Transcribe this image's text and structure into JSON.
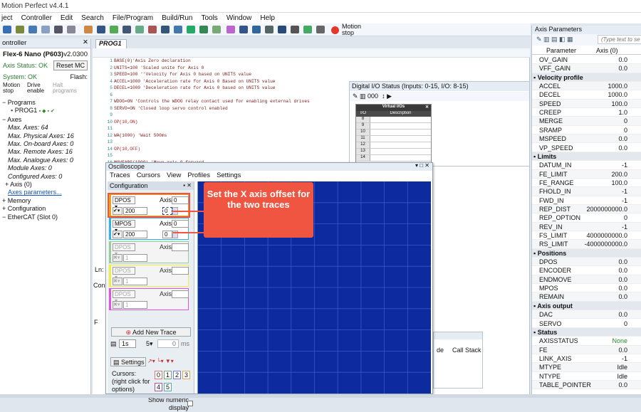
{
  "app": {
    "title": "Motion Perfect v4.4.1"
  },
  "menu": [
    "ject",
    "Controller",
    "Edit",
    "Search",
    "File/Program",
    "Build/Run",
    "Tools",
    "Window",
    "Help"
  ],
  "motion_stop": {
    "label": "Motion stop"
  },
  "controller": {
    "panel_title": "ontroller",
    "device": "Flex-6 Nano (P603)",
    "version": "v2.0300",
    "axis_status_label": "Axis Status: OK",
    "reset_button": "Reset MC",
    "system_status": "System: OK",
    "flash_label": "Flash:",
    "motion_stop": "Motion stop",
    "drive_enable": "Drive enable",
    "halt_programs": "Halt programs",
    "tree": {
      "programs": "Programs",
      "prog1": "PROG1",
      "axes": "Axes",
      "max_axes": "Max. Axes: 64",
      "max_physical": "Max. Physical Axes: 16",
      "max_onboard": "Max. On-board Axes: 0",
      "max_remote": "Max. Remote Axes: 16",
      "max_analogue": "Max. Analogue Axes: 0",
      "module_axes": "Module Axes: 0",
      "configured_axes": "Configured Axes: 0",
      "axis0": "Axis (0)",
      "axes_params_link": "Axes parameters...",
      "memory": "Memory",
      "configuration": "Configuration",
      "ethercat": "EtherCAT (Slot 0)"
    }
  },
  "editor": {
    "tab": "PROG1",
    "lines": [
      "BASE(0)'Axis Zero declaration",
      "UNITS=100 'Scaled unite for Axis 0",
      "SPEED=100 ''Velocity for Axis 0 based on UNITS value",
      "ACCEL=1000 'Acceleration rate for Axis 0 Based on UNITS value",
      "DECEL=1000 'Deceleration rate for Axis 0 based on UNITS value",
      "",
      "WDOG=ON 'Controls the WDOG relay contact used for enabling external drives",
      "SERVO=ON 'Closed loop servo control enabled",
      "",
      "OP(10,ON)",
      "",
      "WA(1000) 'Wait 500ms",
      "",
      "OP(10,OFF)",
      "",
      "MOVEABS(1000) 'Move axis 0 forward",
      "WAIT IDLE 'wait until move is finished",
      "",
      "OP(10,ON)"
    ],
    "line_numbers": [
      "1",
      "2",
      "3",
      "4",
      "5",
      "6",
      "7",
      "8",
      "9",
      "10",
      "11",
      "12",
      "13",
      "14",
      "15",
      "16",
      "17",
      "18",
      "19",
      "20",
      "21",
      "22",
      "23",
      "24",
      "25",
      "26",
      "27",
      "28",
      "29",
      "30",
      "31",
      "32",
      "33",
      "34",
      "35"
    ],
    "ln_label": "Ln:",
    "con_label": "Con",
    "f_label": "F",
    "call_stack": "Call Stack",
    "cut_label": "de"
  },
  "digital_io": {
    "title": "Digital I/O Status (Inputs: 0-15,  I/O: 8-15)",
    "toolbar_value": "000",
    "table_title": "Virtual I/Os",
    "col_io": "I/O",
    "col_desc": "Description",
    "rows": [
      "8",
      "9",
      "10",
      "11",
      "12",
      "13",
      "14"
    ]
  },
  "oscilloscope": {
    "title": "Oscilloscope",
    "menu": [
      "Traces",
      "Cursors",
      "View",
      "Profiles",
      "Settings"
    ],
    "config_label": "Configuration",
    "traces": [
      {
        "param": "DPOS",
        "axis_label": "Axis",
        "axis": "0",
        "scale": "200",
        "offset": "0"
      },
      {
        "param": "MPOS",
        "axis_label": "Axis",
        "axis": "0",
        "scale": "200",
        "offset": "0"
      },
      {
        "param": "DPOS",
        "axis_label": "Axis",
        "axis": "",
        "scale": "1",
        "offset": ""
      },
      {
        "param": "DPOS",
        "axis_label": "Axis",
        "axis": "",
        "scale": "1",
        "offset": ""
      },
      {
        "param": "DPOS",
        "axis_label": "Axis",
        "axis": "",
        "scale": "1",
        "offset": ""
      }
    ],
    "add_trace": "Add New Trace",
    "time_value": "1s",
    "samples_value": "0",
    "samples_unit": "ms",
    "settings_button": "Settings",
    "cursors_label": "Cursors:",
    "cursors_hint": "(right click for options)",
    "cursor_buttons": [
      "0",
      "1",
      "2",
      "3",
      "4",
      "5"
    ],
    "show_numeric": "Show numeric display"
  },
  "callout": {
    "text": "Set the X axis offset for the two traces"
  },
  "axis_params": {
    "title": "Axis Parameters",
    "search_placeholder": "(Type text to se",
    "col_param": "Parameter",
    "col_axis": "Axis (0)",
    "rows": [
      {
        "k": "OV_GAIN",
        "v": "0.0"
      },
      {
        "k": "VFF_GAIN",
        "v": "0.0"
      },
      {
        "section": "Velocity profile"
      },
      {
        "k": "ACCEL",
        "v": "1000.0"
      },
      {
        "k": "DECEL",
        "v": "1000.0"
      },
      {
        "k": "SPEED",
        "v": "100.0"
      },
      {
        "k": "CREEP",
        "v": "1.0"
      },
      {
        "k": "MERGE",
        "v": "0"
      },
      {
        "k": "SRAMP",
        "v": "0"
      },
      {
        "k": "MSPEED",
        "v": "0.0"
      },
      {
        "k": "VP_SPEED",
        "v": "0.0"
      },
      {
        "section": "Limits"
      },
      {
        "k": "DATUM_IN",
        "v": "-1"
      },
      {
        "k": "FE_LIMIT",
        "v": "200.0"
      },
      {
        "k": "FE_RANGE",
        "v": "100.0"
      },
      {
        "k": "FHOLD_IN",
        "v": "-1"
      },
      {
        "k": "FWD_IN",
        "v": "-1"
      },
      {
        "k": "REP_DIST",
        "v": "2000000000.0"
      },
      {
        "k": "REP_OPTION",
        "v": "0"
      },
      {
        "k": "REV_IN",
        "v": "-1"
      },
      {
        "k": "FS_LIMIT",
        "v": "4000000000.0"
      },
      {
        "k": "RS_LIMIT",
        "v": "-4000000000.0"
      },
      {
        "section": "Positions"
      },
      {
        "k": "DPOS",
        "v": "0.0"
      },
      {
        "k": "ENCODER",
        "v": "0.0"
      },
      {
        "k": "ENDMOVE",
        "v": "0.0"
      },
      {
        "k": "MPOS",
        "v": "0.0"
      },
      {
        "k": "REMAIN",
        "v": "0.0"
      },
      {
        "section": "Axis output"
      },
      {
        "k": "DAC",
        "v": "0.0"
      },
      {
        "k": "SERVO",
        "v": "0"
      },
      {
        "section": "Status"
      },
      {
        "k": "AXISSTATUS",
        "v": "None"
      },
      {
        "k": "FE",
        "v": "0.0"
      },
      {
        "k": "LINK_AXIS",
        "v": "-1"
      },
      {
        "k": "MTYPE",
        "v": "Idle"
      },
      {
        "k": "NTYPE",
        "v": "Idle"
      },
      {
        "k": "TABLE_POINTER",
        "v": "0.0"
      }
    ]
  },
  "colors": {
    "scope_bg": "#0d2a9f",
    "callout": "#ef5540",
    "trace1": "#e8a020",
    "trace2": "#3ab0e0"
  }
}
